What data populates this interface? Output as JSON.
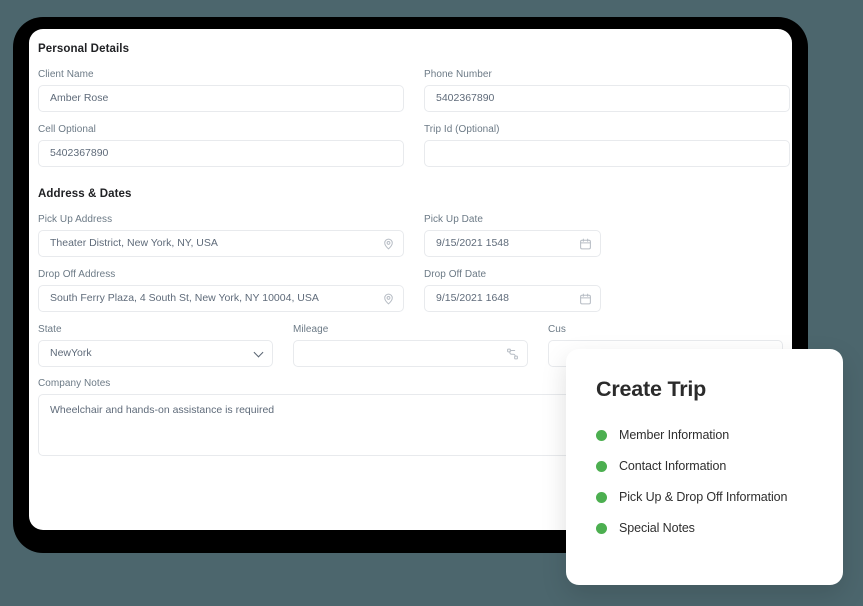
{
  "theme": {
    "page_background": "#4C666D",
    "device_frame": "#000000",
    "surface": "#FFFFFF",
    "bullet_green": "#4CAF50",
    "label_gray": "#6C7A86",
    "value_gray": "#5F6B7A",
    "border_gray": "#E8EAED",
    "heading_black": "#202124"
  },
  "form": {
    "sections": [
      {
        "title": "Personal Details"
      },
      {
        "title": "Address & Dates"
      }
    ],
    "personal_details": {
      "client_name": {
        "label": "Client Name",
        "value": "Amber Rose",
        "placeholder": ""
      },
      "phone_number": {
        "label": "Phone Number",
        "value": "5402367890",
        "placeholder": ""
      },
      "cell_optional": {
        "label": "Cell Optional",
        "value": "5402367890",
        "placeholder": ""
      },
      "trip_id": {
        "label": "Trip Id (Optional)",
        "value": "",
        "placeholder": ""
      }
    },
    "address_dates": {
      "pick_up_address": {
        "label": "Pick Up Address",
        "value": "Theater District, New York, NY, USA",
        "placeholder": "",
        "icon": "location-pin-icon"
      },
      "pick_up_date": {
        "label": "Pick Up Date",
        "value": "9/15/2021 1548",
        "placeholder": "",
        "icon": "calendar-icon"
      },
      "drop_off_address": {
        "label": "Drop Off Address",
        "value": "South Ferry Plaza, 4 South St, New York, NY 10004, USA",
        "placeholder": "",
        "icon": "location-pin-icon"
      },
      "drop_off_date": {
        "label": "Drop Off Date",
        "value": "9/15/2021 1648",
        "placeholder": "",
        "icon": "calendar-icon"
      },
      "state": {
        "label": "State",
        "value": "NewYork",
        "icon": "chevron-down-icon"
      },
      "mileage": {
        "label": "Mileage",
        "value": "",
        "placeholder": "",
        "icon": "route-icon"
      },
      "custom": {
        "label": "Cus",
        "value": "",
        "placeholder": ""
      }
    },
    "company_notes": {
      "label": "Company Notes",
      "value": "Wheelchair and hands-on assistance is required",
      "placeholder": ""
    }
  },
  "create_trip_card": {
    "title": "Create Trip",
    "items": [
      {
        "label": "Member Information"
      },
      {
        "label": "Contact Information"
      },
      {
        "label": "Pick Up & Drop Off Information"
      },
      {
        "label": "Special Notes"
      }
    ]
  }
}
